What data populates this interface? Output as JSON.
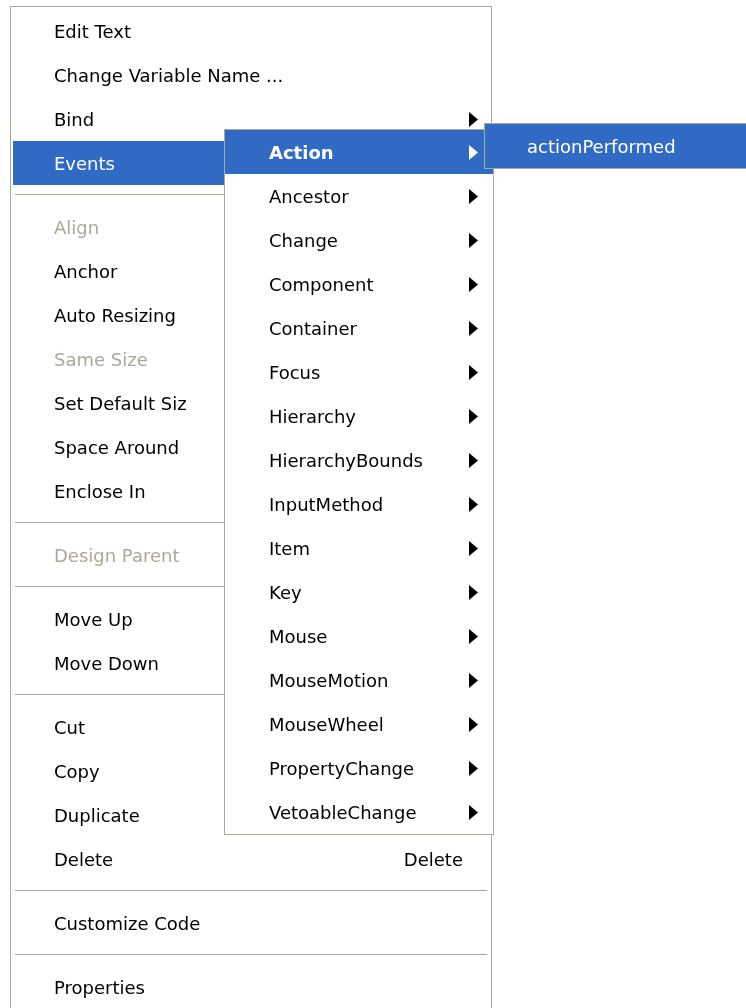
{
  "menu": {
    "items": [
      {
        "kind": "item",
        "label": "Edit Text",
        "disabled": false,
        "selected": false,
        "has_submenu": false
      },
      {
        "kind": "item",
        "label": "Change Variable Name ...",
        "disabled": false,
        "selected": false,
        "has_submenu": false
      },
      {
        "kind": "item",
        "label": "Bind",
        "disabled": false,
        "selected": false,
        "has_submenu": true
      },
      {
        "kind": "item",
        "label": "Events",
        "disabled": false,
        "selected": true
      },
      {
        "kind": "separator"
      },
      {
        "kind": "item",
        "label": "Align",
        "disabled": true,
        "selected": false
      },
      {
        "kind": "item",
        "label": "Anchor",
        "disabled": false,
        "selected": false
      },
      {
        "kind": "item",
        "label": "Auto Resizing",
        "disabled": false,
        "selected": false
      },
      {
        "kind": "item",
        "label": "Same Size",
        "disabled": true,
        "selected": false
      },
      {
        "kind": "item",
        "label": "Set Default Siz",
        "disabled": false,
        "selected": false
      },
      {
        "kind": "item",
        "label": "Space Around",
        "disabled": false,
        "selected": false
      },
      {
        "kind": "item",
        "label": "Enclose In",
        "disabled": false,
        "selected": false
      },
      {
        "kind": "separator"
      },
      {
        "kind": "item",
        "label": "Design Parent",
        "disabled": true,
        "selected": false
      },
      {
        "kind": "separator"
      },
      {
        "kind": "item",
        "label": "Move Up",
        "disabled": false,
        "selected": false
      },
      {
        "kind": "item",
        "label": "Move Down",
        "disabled": false,
        "selected": false
      },
      {
        "kind": "separator"
      },
      {
        "kind": "item",
        "label": "Cut",
        "disabled": false,
        "selected": false
      },
      {
        "kind": "item",
        "label": "Copy",
        "disabled": false,
        "selected": false
      },
      {
        "kind": "item",
        "label": "Duplicate",
        "disabled": false,
        "selected": false
      },
      {
        "kind": "item",
        "label": "Delete",
        "shortcut": "Delete",
        "disabled": false,
        "selected": false,
        "has_submenu": false
      },
      {
        "kind": "separator"
      },
      {
        "kind": "item",
        "label": "Customize Code",
        "disabled": false,
        "selected": false,
        "has_submenu": false
      },
      {
        "kind": "separator"
      },
      {
        "kind": "item",
        "label": "Properties",
        "disabled": false,
        "selected": false,
        "has_submenu": false
      }
    ]
  },
  "events_submenu": {
    "items": [
      {
        "label": "Action",
        "selected": true,
        "has_submenu": true
      },
      {
        "label": "Ancestor",
        "selected": false,
        "has_submenu": true
      },
      {
        "label": "Change",
        "selected": false,
        "has_submenu": true
      },
      {
        "label": "Component",
        "selected": false,
        "has_submenu": true
      },
      {
        "label": "Container",
        "selected": false,
        "has_submenu": true
      },
      {
        "label": "Focus",
        "selected": false,
        "has_submenu": true
      },
      {
        "label": "Hierarchy",
        "selected": false,
        "has_submenu": true
      },
      {
        "label": "HierarchyBounds",
        "selected": false,
        "has_submenu": true
      },
      {
        "label": "InputMethod",
        "selected": false,
        "has_submenu": true
      },
      {
        "label": "Item",
        "selected": false,
        "has_submenu": true
      },
      {
        "label": "Key",
        "selected": false,
        "has_submenu": true
      },
      {
        "label": "Mouse",
        "selected": false,
        "has_submenu": true
      },
      {
        "label": "MouseMotion",
        "selected": false,
        "has_submenu": true
      },
      {
        "label": "MouseWheel",
        "selected": false,
        "has_submenu": true
      },
      {
        "label": "PropertyChange",
        "selected": false,
        "has_submenu": true
      },
      {
        "label": "VetoableChange",
        "selected": false,
        "has_submenu": true
      }
    ]
  },
  "action_submenu": {
    "items": [
      {
        "label": "actionPerformed",
        "selected": true,
        "has_submenu": false
      }
    ]
  }
}
